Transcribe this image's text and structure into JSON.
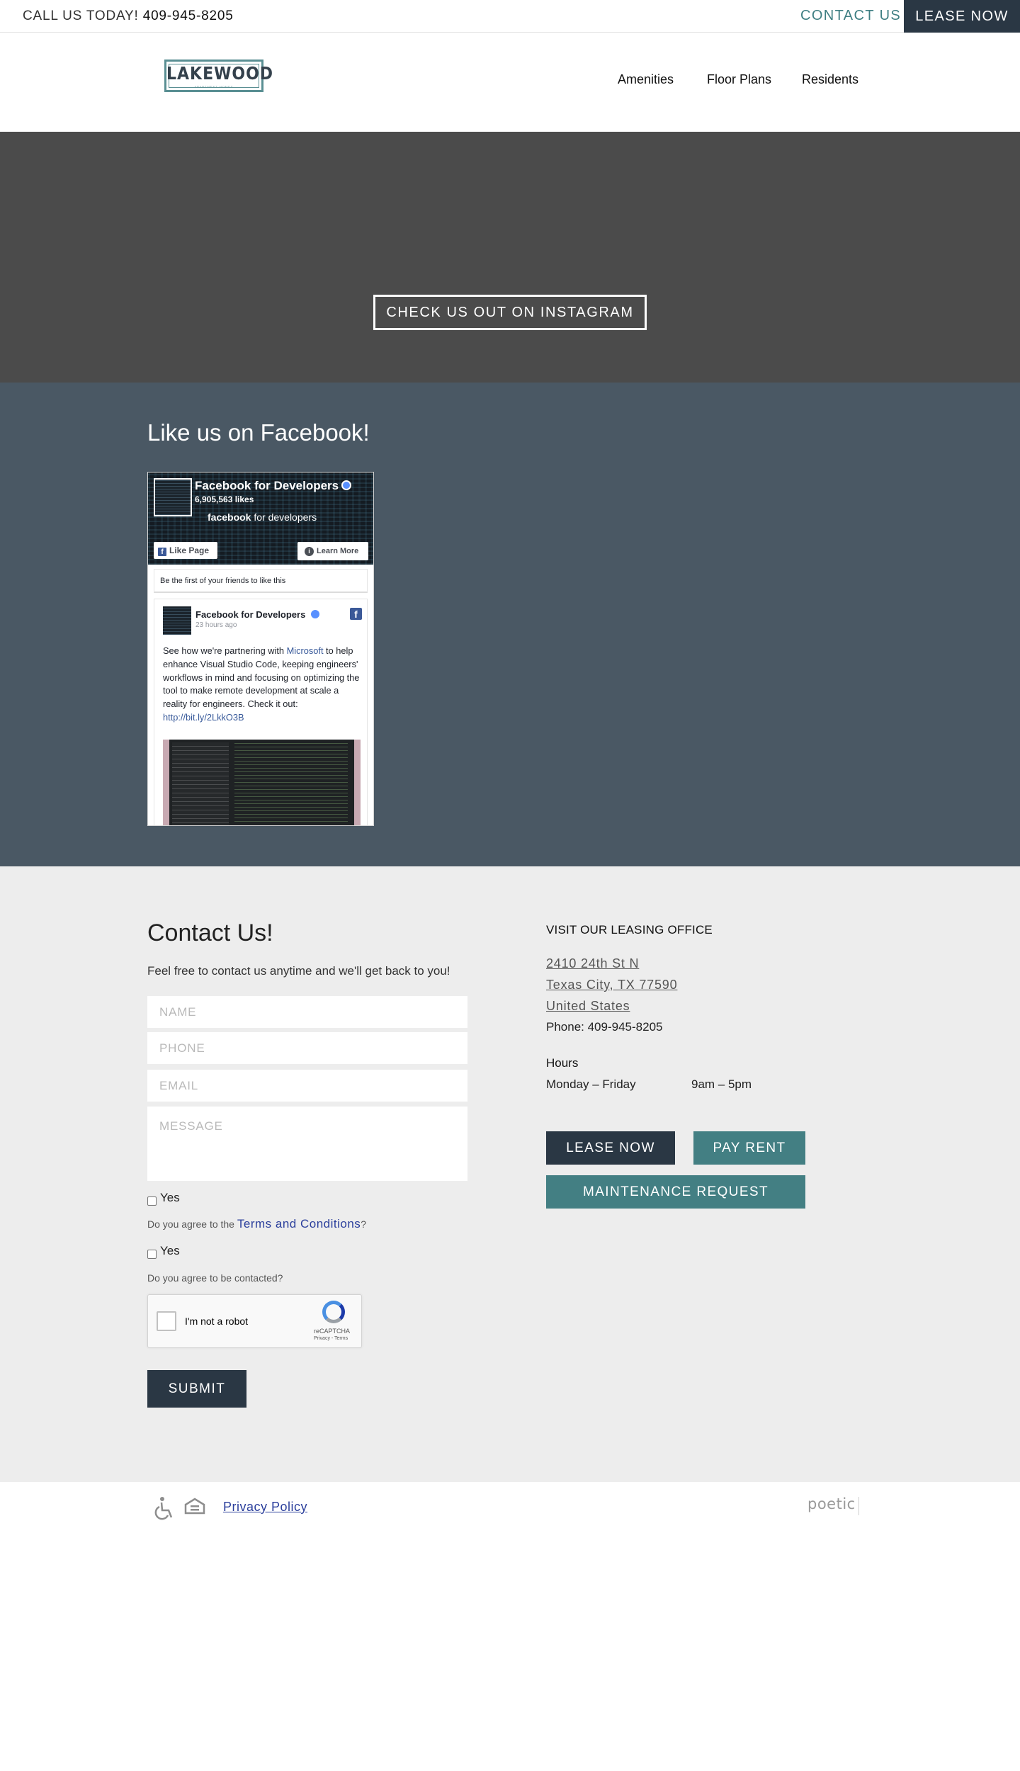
{
  "topbar": {
    "call_label": "CALL US TODAY!",
    "call_number": "409-945-8205",
    "contact_label": "CONTACT US",
    "lease_label": "LEASE NOW"
  },
  "header": {
    "logo_text": "LAKEWOOD",
    "logo_sub": "APARTMENT HOMES",
    "nav": [
      "Amenities",
      "Floor Plans",
      "Residents"
    ]
  },
  "hero": {
    "instagram_label": "CHECK US OUT ON INSTAGRAM"
  },
  "facebook": {
    "heading": "Like us on Facebook!",
    "page_name": "Facebook for Developers",
    "likes": "6,905,563 likes",
    "brand_bold": "facebook",
    "brand_rest": " for developers",
    "like_page_label": "Like Page",
    "learn_more_label": "Learn More",
    "friends_text": "Be the first of your friends to like this",
    "post_author": "Facebook for Developers",
    "post_time": "23 hours ago",
    "post_text_1": "See how we're partnering with ",
    "post_link_1": "Microsoft",
    "post_text_2": " to help enhance Visual Studio Code, keeping engineers' workflows in mind and focusing on optimizing the tool to make remote development at scale a reality for engineers. Check it out: ",
    "post_link_2": "http://bit.ly/2LkkO3B"
  },
  "contact": {
    "heading": "Contact Us!",
    "intro": "Feel free to contact us anytime and we'll get back to you!",
    "name_placeholder": "NAME",
    "phone_placeholder": "PHONE",
    "email_placeholder": "EMAIL",
    "message_placeholder": "MESSAGE",
    "yes_label": "Yes",
    "terms_prefix": "Do you agree to the ",
    "terms_link": "Terms and Conditions",
    "terms_suffix": "?",
    "contacted_question": "Do you agree to be contacted?",
    "recaptcha_label": "I'm not a robot",
    "recaptcha_brand": "reCAPTCHA",
    "recaptcha_terms": "Privacy - Terms",
    "submit_label": "SUBMIT"
  },
  "office": {
    "heading": "VISIT OUR LEASING OFFICE",
    "address_1": "2410 24th St N",
    "address_2": "Texas City, TX 77590",
    "address_3": "United States",
    "phone": "Phone: 409-945-8205",
    "hours_heading": "Hours",
    "hours_days": "Monday – Friday",
    "hours_time": "9am – 5pm",
    "lease_label": "LEASE NOW",
    "pay_rent_label": "PAY RENT",
    "maintenance_label": "MAINTENANCE REQUEST"
  },
  "footer": {
    "privacy_label": "Privacy Policy",
    "credit": "poetic"
  },
  "colors": {
    "navy": "#2a3744",
    "teal": "#437f83",
    "hero_gray": "#4b4b4b",
    "slate": "#4a5864",
    "light_gray": "#ededed"
  }
}
